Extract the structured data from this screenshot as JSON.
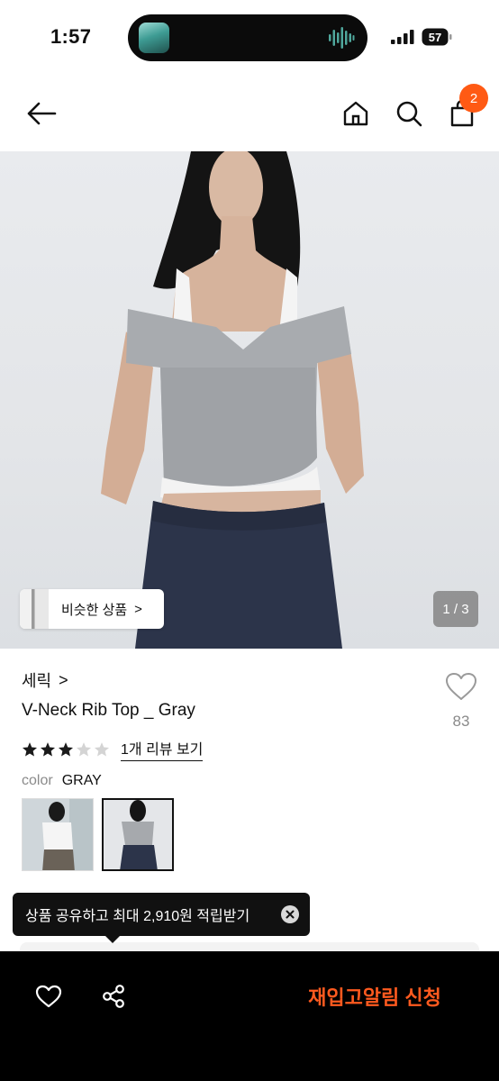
{
  "status_bar": {
    "time": "1:57",
    "battery": "57"
  },
  "header": {
    "cart_count": "2"
  },
  "hero": {
    "similar_label": "비슷한 상품",
    "similar_chevron": ">",
    "page_indicator": "1 / 3"
  },
  "product": {
    "brand": "세릭",
    "brand_chevron": ">",
    "title": "V-Neck Rib Top _ Gray",
    "likes": "83",
    "rating": 3,
    "rating_max": 5,
    "review_link": "1개 리뷰 보기",
    "color_label": "color",
    "color_value": "GRAY"
  },
  "tooltip": {
    "text": "상품 공유하고 최대 2,910원 적립받기"
  },
  "bottom_bar": {
    "restock_label": "재입고알림 신청"
  },
  "colors": {
    "accent": "#ff5a14",
    "restock": "#ff5a1f",
    "star_on": "#1a1a1a",
    "star_off": "#d4d4d4"
  }
}
